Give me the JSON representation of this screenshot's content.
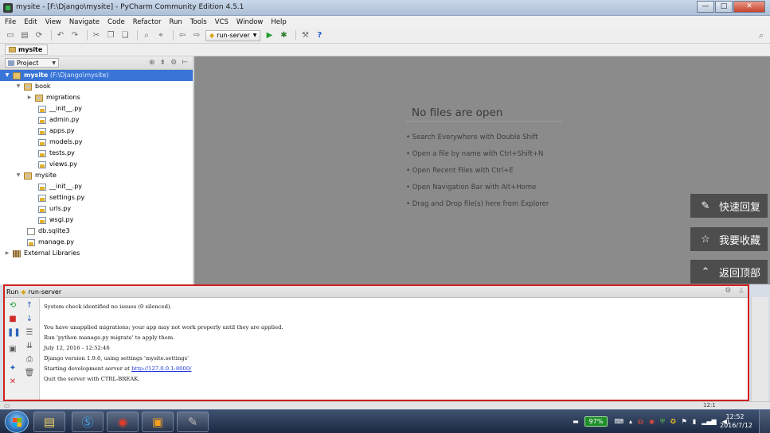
{
  "window": {
    "title": "mysite - [F:\\Django\\mysite] - PyCharm Community Edition 4.5.1",
    "buttons": {
      "minimize": "—",
      "maximize": "□",
      "close": "✕"
    }
  },
  "menu": [
    "File",
    "Edit",
    "View",
    "Navigate",
    "Code",
    "Refactor",
    "Run",
    "Tools",
    "VCS",
    "Window",
    "Help"
  ],
  "toolbar": {
    "run_config": "run-server"
  },
  "breadcrumb": {
    "item": "mysite"
  },
  "project_panel": {
    "view_label": "Project",
    "tree": [
      {
        "label": "mysite",
        "path": " (F:\\Django\\mysite)",
        "level": 0,
        "icon": "folder",
        "arrow": "▼",
        "selected": true
      },
      {
        "label": "book",
        "level": 1,
        "icon": "pkg",
        "arrow": "▼"
      },
      {
        "label": "migrations",
        "level": 2,
        "icon": "pkg",
        "arrow": "▶"
      },
      {
        "label": "__init__.py",
        "level": 3,
        "icon": "pyfile"
      },
      {
        "label": "admin.py",
        "level": 3,
        "icon": "pyfile"
      },
      {
        "label": "apps.py",
        "level": 3,
        "icon": "pyfile"
      },
      {
        "label": "models.py",
        "level": 3,
        "icon": "pyfile"
      },
      {
        "label": "tests.py",
        "level": 3,
        "icon": "pyfile"
      },
      {
        "label": "views.py",
        "level": 3,
        "icon": "pyfile"
      },
      {
        "label": "mysite",
        "level": 1,
        "icon": "pkg",
        "arrow": "▼"
      },
      {
        "label": "__init__.py",
        "level": 3,
        "icon": "pyfile"
      },
      {
        "label": "settings.py",
        "level": 3,
        "icon": "pyfile"
      },
      {
        "label": "urls.py",
        "level": 3,
        "icon": "pyfile"
      },
      {
        "label": "wsgi.py",
        "level": 3,
        "icon": "pyfile"
      },
      {
        "label": "db.sqlite3",
        "level": 2,
        "icon": "dbfile"
      },
      {
        "label": "manage.py",
        "level": 2,
        "icon": "pyfile"
      },
      {
        "label": "External Libraries",
        "level": 0,
        "icon": "lib",
        "arrow": "▶"
      }
    ]
  },
  "editor": {
    "empty_title": "No files are open",
    "hints": [
      "• Search Everywhere with Double Shift",
      "• Open a file by name with Ctrl+Shift+N",
      "• Open Recent Files with Ctrl+E",
      "• Open Navigation Bar with Alt+Home",
      "• Drag and Drop file(s) here from Explorer"
    ]
  },
  "floating_buttons": [
    {
      "label": "快速回复",
      "icon": "pencil-icon"
    },
    {
      "label": "我要收藏",
      "icon": "star-icon"
    },
    {
      "label": "返回顶部",
      "icon": "chevron-up-icon"
    }
  ],
  "run_panel": {
    "tab_prefix": "Run",
    "config": "run-server",
    "lines": [
      "System check identified no issues (0 silenced).",
      "",
      "You have unapplied migrations; your app may not work properly until they are applied.",
      "Run 'python manage.py migrate' to apply them.",
      "July 12, 2016 - 12:52:46",
      "Django version 1.9.6, using settings 'mysite.settings'",
      "Starting development server at ",
      "Quit the server with CTRL-BREAK."
    ],
    "server_url": "http://127.0.0.1:8000/"
  },
  "statusbar": {
    "position": "12:1"
  },
  "taskbar": {
    "battery": "97%",
    "time": "12:52",
    "date": "2016/7/12"
  },
  "colors": {
    "selection": "#3875d7",
    "highlight_border": "#d21f1f",
    "editor_bg": "#8b8b8b"
  }
}
